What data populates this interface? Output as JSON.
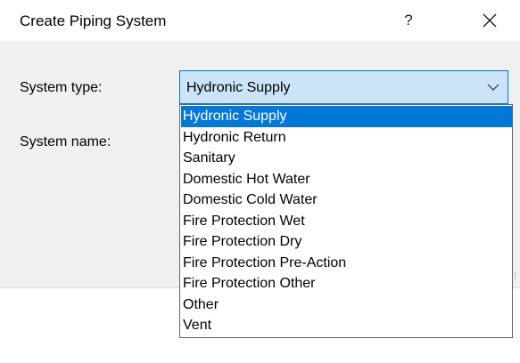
{
  "window": {
    "title": "Create Piping System",
    "help_label": "?",
    "close_icon": "close-icon"
  },
  "form": {
    "system_type_label": "System type:",
    "system_name_label": "System name:",
    "system_type_value": "Hydronic Supply"
  },
  "dropdown": {
    "options": [
      "Hydronic Supply",
      "Hydronic Return",
      "Sanitary",
      "Domestic Hot Water",
      "Domestic Cold Water",
      "Fire Protection Wet",
      "Fire Protection Dry",
      "Fire Protection Pre-Action",
      "Fire Protection Other",
      "Other",
      "Vent"
    ],
    "selected_index": 0
  },
  "colors": {
    "accent": "#0078d7",
    "combo_focus_fill": "#cce4f7",
    "dialog_background": "#f0f0f0"
  }
}
